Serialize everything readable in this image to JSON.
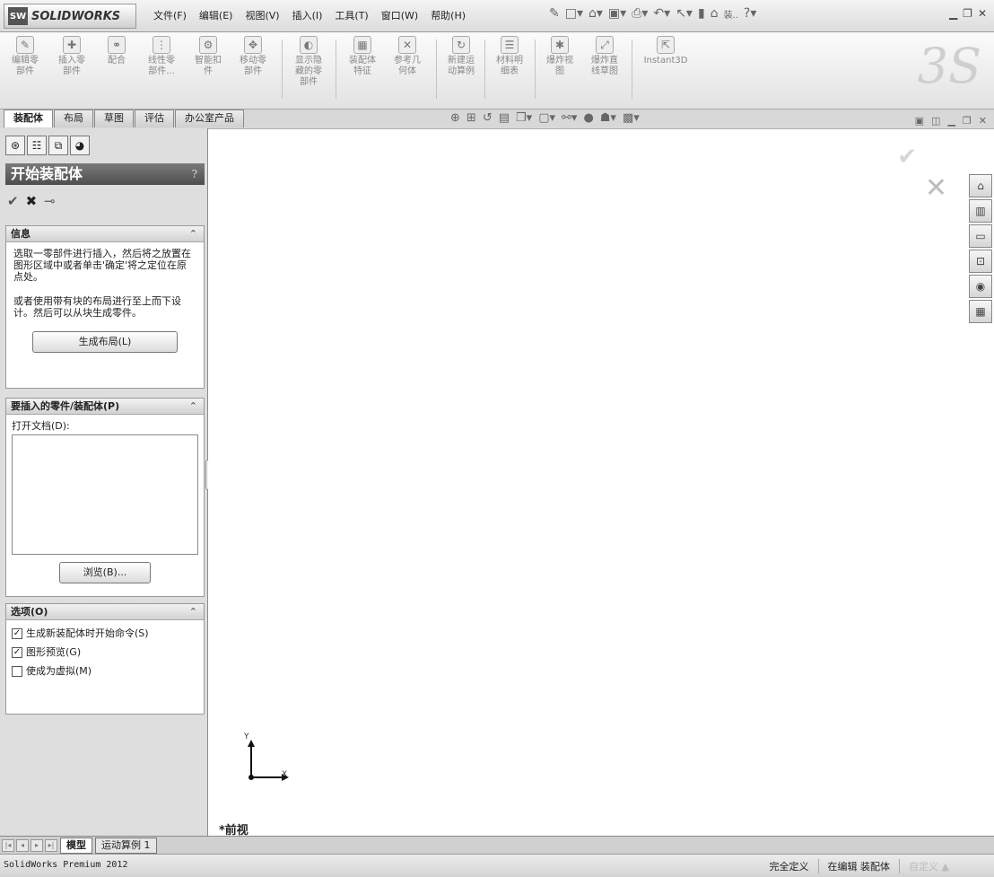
{
  "app": {
    "logo_mark": "SW",
    "logo_text": "SOLIDWORKS"
  },
  "menus": [
    "文件(F)",
    "编辑(E)",
    "视图(V)",
    "插入(I)",
    "工具(T)",
    "窗口(W)",
    "帮助(H)"
  ],
  "quick_access_extra": "装..",
  "command_manager": {
    "items": [
      {
        "label": "编辑零\n部件",
        "icon": "edit-component-icon"
      },
      {
        "label": "插入零\n部件",
        "icon": "insert-component-icon"
      },
      {
        "label": "配合",
        "icon": "mate-icon"
      },
      {
        "label": "线性零\n部件...",
        "icon": "linear-pattern-icon"
      },
      {
        "label": "智能扣\n件",
        "icon": "smart-fasteners-icon"
      },
      {
        "label": "移动零\n部件",
        "icon": "move-component-icon"
      },
      {
        "label": "显示隐\n藏的零\n部件",
        "icon": "show-hidden-icon"
      },
      {
        "label": "装配体\n特征",
        "icon": "assembly-features-icon"
      },
      {
        "label": "参考几\n何体",
        "icon": "reference-geometry-icon"
      },
      {
        "label": "新建运\n动算例",
        "icon": "new-motion-study-icon"
      },
      {
        "label": "材料明\n细表",
        "icon": "bom-icon"
      },
      {
        "label": "爆炸视\n图",
        "icon": "exploded-view-icon"
      },
      {
        "label": "爆炸直\n线草图",
        "icon": "explode-line-sketch-icon"
      },
      {
        "label": "Instant3D",
        "icon": "instant3d-icon"
      }
    ],
    "tabs": [
      {
        "label": "装配体",
        "active": true
      },
      {
        "label": "布局",
        "active": false
      },
      {
        "label": "草图",
        "active": false
      },
      {
        "label": "评估",
        "active": false
      },
      {
        "label": "办公室产品",
        "active": false
      }
    ]
  },
  "property_manager": {
    "title": "开始装配体",
    "help": "?",
    "info": {
      "heading": "信息",
      "text1": "选取一零部件进行插入，然后将之放置在图形区域中或者单击'确定'将之定位在原点处。",
      "text2": "或者使用带有块的布局进行至上而下设计。然后可以从块生成零件。",
      "button": "生成布局(L)"
    },
    "parts": {
      "heading": "要插入的零件/装配体(P)",
      "open_docs_label": "打开文档(D):",
      "browse_button": "浏览(B)..."
    },
    "options": {
      "heading": "选项(O)",
      "items": [
        {
          "label": "生成新装配体时开始命令(S)",
          "checked": true
        },
        {
          "label": "图形预览(G)",
          "checked": true
        },
        {
          "label": "使成为虚拟(M)",
          "checked": false
        }
      ]
    }
  },
  "graphics": {
    "axis_y": "Y",
    "axis_x": "X",
    "view_name": "*前视"
  },
  "bottom_tabs": [
    {
      "label": "模型",
      "active": true
    },
    {
      "label": "运动算例 1",
      "active": false
    }
  ],
  "status_bar": {
    "app_version": "SolidWorks Premium 2012",
    "state": "完全定义",
    "editing": "在编辑 装配体",
    "custom": "自定义 ▲"
  }
}
